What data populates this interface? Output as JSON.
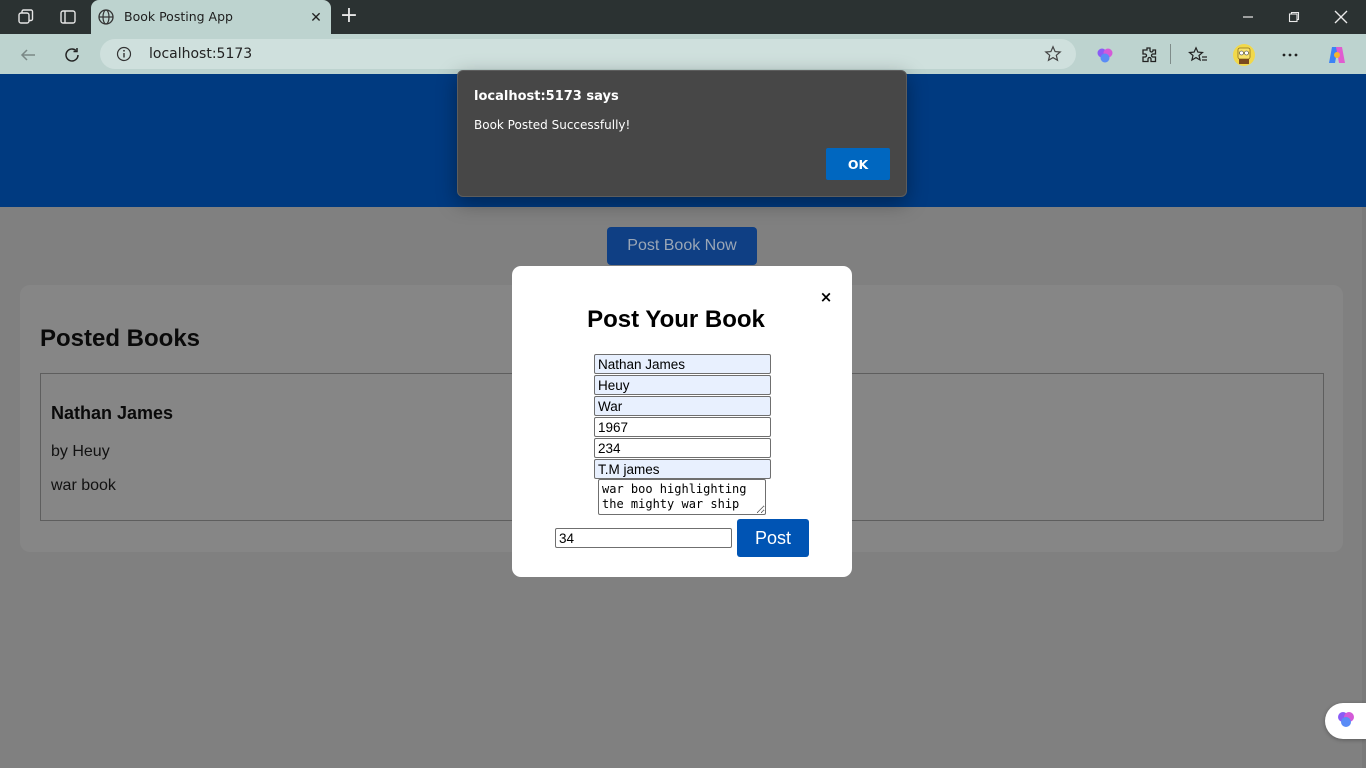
{
  "browser": {
    "tab_title": "Book Posting App",
    "address": "localhost:5173",
    "new_tab_glyph": "+",
    "tab_close_glyph": "✕",
    "icons": [
      "workspaces-icon",
      "tab-actions-icon",
      "globe-icon",
      "back-icon",
      "reload-icon",
      "info-icon",
      "favorite-star-icon",
      "copilot-brain-icon",
      "extensions-icon",
      "favorites-icon",
      "profile-avatar-icon",
      "more-icon",
      "copilot-icon",
      "minimize-icon",
      "restore-icon",
      "close-window-icon"
    ]
  },
  "page": {
    "post_now_label": "Post Book Now",
    "posted_books_heading": "Posted Books",
    "books": [
      {
        "title": "Nathan James",
        "author_line": "by Heuy",
        "description": "war book"
      }
    ]
  },
  "modal": {
    "close_glyph": "×",
    "title": "Post Your Book",
    "fields": {
      "title": "Nathan James",
      "author": "Heuy",
      "genre": "War",
      "year": "1967",
      "pages": "234",
      "publisher": "T.M james",
      "description": "war boo highlighting the mighty war ship",
      "price": "34"
    },
    "submit_label": "Post"
  },
  "alert": {
    "heading": "localhost:5173 says",
    "message": "Book Posted Successfully!",
    "ok_label": "OK"
  },
  "colors": {
    "hero_blue": "#003a80",
    "primary_button": "#0054b4",
    "alert_ok": "#0067c0",
    "overlay_gray": "#808080"
  }
}
